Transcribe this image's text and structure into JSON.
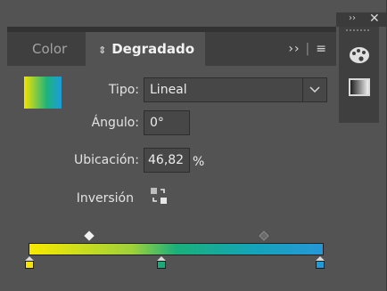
{
  "tabs": {
    "color_label": "Color",
    "degradado_label": "Degradado",
    "updown_glyph": "⇕",
    "expand_glyph": "››",
    "menu_glyph": "≡"
  },
  "gradient": {
    "type_label": "Tipo:",
    "type_value": "Lineal",
    "angle_label": "Ángulo:",
    "angle_value": "0°",
    "location_label": "Ubicación:",
    "location_value": "46,82",
    "location_unit": "%",
    "reverse_label": "Inversión"
  },
  "colors": {
    "stop_left": "#f5e400",
    "stop_mid": "#1aa97a",
    "stop_right": "#1e9bd9"
  },
  "icons": {
    "tab_updown": "sort-updown-icon",
    "expand": "double-chevron-right-icon",
    "menu": "hamburger-menu-icon",
    "select_arrow": "chevron-down-icon",
    "reverse": "reverse-gradient-icon",
    "palette": "palette-icon",
    "gradient_panel": "gradient-panel-icon",
    "collapse": "double-chevron-right-icon",
    "close": "close-icon"
  },
  "side_header": {
    "collapse_glyph": "››",
    "close_glyph": "✕"
  }
}
